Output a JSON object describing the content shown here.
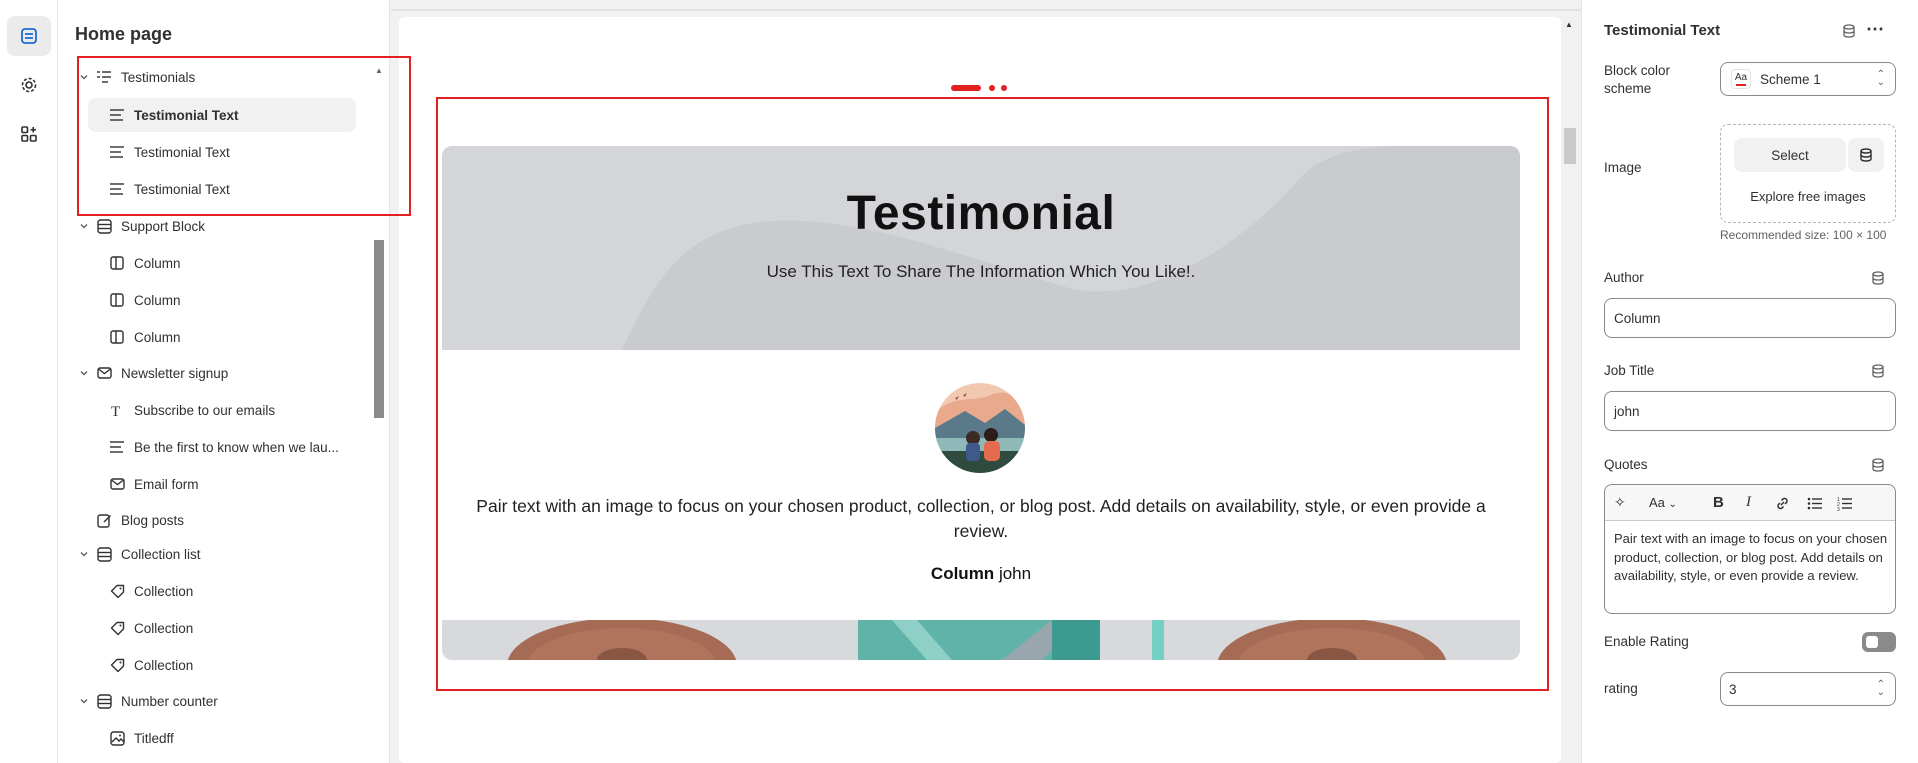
{
  "sidebar_title": "Home page",
  "tree": [
    {
      "label": "Testimonials",
      "level": 0,
      "icon": "section-list-icon"
    },
    {
      "label": "Testimonial Text",
      "level": 1,
      "icon": "text-lines-icon",
      "selected": true
    },
    {
      "label": "Testimonial Text",
      "level": 1,
      "icon": "text-lines-icon"
    },
    {
      "label": "Testimonial Text",
      "level": 1,
      "icon": "text-lines-icon"
    },
    {
      "label": "Support Block",
      "level": 0,
      "icon": "section-icon"
    },
    {
      "label": "Column",
      "level": 1,
      "icon": "column-icon"
    },
    {
      "label": "Column",
      "level": 1,
      "icon": "column-icon"
    },
    {
      "label": "Column",
      "level": 1,
      "icon": "column-icon"
    },
    {
      "label": "Newsletter signup",
      "level": 0,
      "icon": "email-icon"
    },
    {
      "label": "Subscribe to our emails",
      "level": 1,
      "icon": "heading-t-icon"
    },
    {
      "label": "Be the first to know when we lau...",
      "level": 1,
      "icon": "text-lines-icon"
    },
    {
      "label": "Email form",
      "level": 1,
      "icon": "email-icon"
    },
    {
      "label": "Blog posts",
      "level": 0,
      "icon": "blog-icon"
    },
    {
      "label": "Collection list",
      "level": 0,
      "icon": "section-icon"
    },
    {
      "label": "Collection",
      "level": 1,
      "icon": "tag-icon"
    },
    {
      "label": "Collection",
      "level": 1,
      "icon": "tag-icon"
    },
    {
      "label": "Collection",
      "level": 1,
      "icon": "tag-icon"
    },
    {
      "label": "Number counter",
      "level": 0,
      "icon": "section-icon"
    },
    {
      "label": "Titledff",
      "level": 1,
      "icon": "image-icon"
    }
  ],
  "preview": {
    "hero_title": "Testimonial",
    "hero_subtitle": "Use This Text To Share The Information Which You Like!.",
    "quote": "Pair text with an image to focus on your chosen product, collection, or blog post. Add details on availability, style, or even provide a review.",
    "author": "Column",
    "job": "john"
  },
  "settings": {
    "title": "Testimonial Text",
    "color_scheme_label": "Block color scheme",
    "color_scheme_value": "Scheme 1",
    "color_scheme_swatch": "Aa",
    "image_label": "Image",
    "select_btn": "Select",
    "explore_link": "Explore free images",
    "image_hint": "Recommended size: 100 × 100",
    "author_label": "Author",
    "author_value": "Column",
    "job_label": "Job Title",
    "job_value": "john",
    "quotes_label": "Quotes",
    "quotes_text": "Pair text with an image to focus on your chosen product, collection, or blog post. Add details on availability, style, or even provide a review.",
    "rte_font_label": "Aa",
    "rating_toggle_label": "Enable Rating",
    "rating_toggle_on": false,
    "rating_label": "rating",
    "rating_value": "3"
  },
  "colors": {
    "highlight": "#e22120",
    "hero_bg": "#d3d5d8"
  }
}
